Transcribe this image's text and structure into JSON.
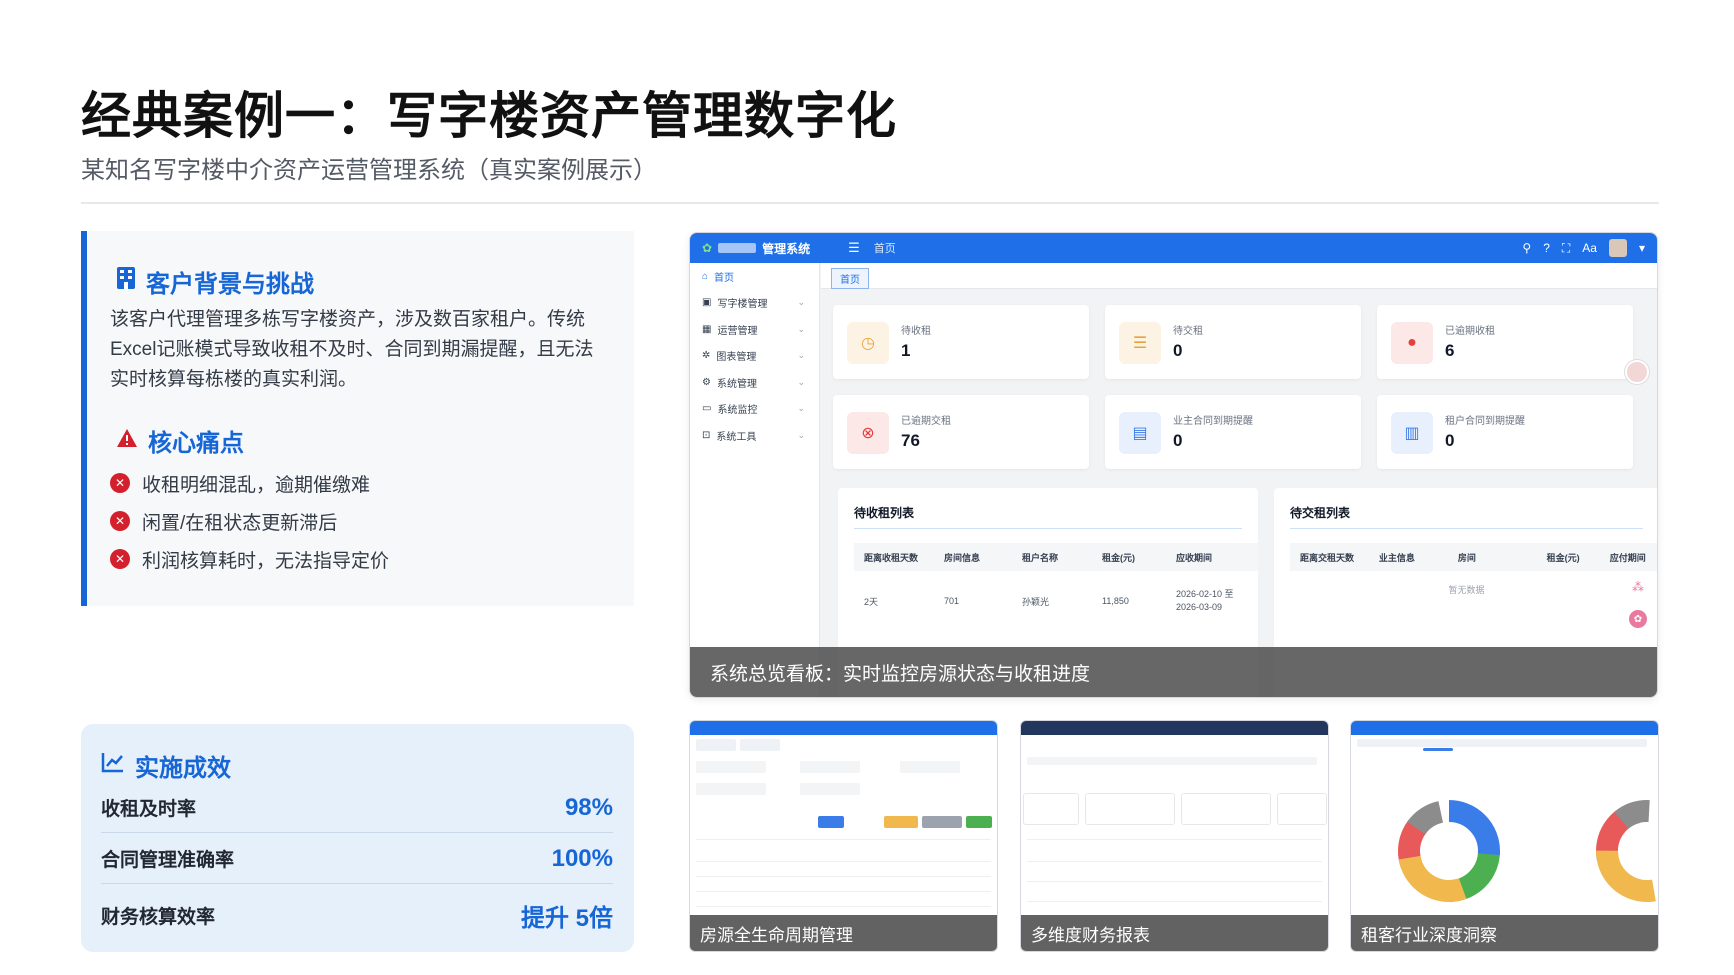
{
  "header": {
    "title": "经典案例一：写字楼资产管理数字化",
    "subtitle": "某知名写字楼中介资产运营管理系统（真实案例展示）"
  },
  "background": {
    "title": "客户背景与挑战",
    "text": "该客户代理管理多栋写字楼资产，涉及数百家租户。传统Excel记账模式导致收租不及时、合同到期漏提醒，且无法实时核算每栋楼的真实利润。",
    "pain_title": "核心痛点",
    "pain_points": [
      "收租明细混乱，逾期催缴难",
      "闲置/在租状态更新滞后",
      "利润核算耗时，无法指导定价"
    ]
  },
  "results": {
    "title": "实施成效",
    "rows": [
      {
        "label": "收租及时率",
        "value": "98%"
      },
      {
        "label": "合同管理准确率",
        "value": "100%"
      },
      {
        "label": "财务核算效率",
        "value": "提升 5倍"
      }
    ]
  },
  "screenshot": {
    "brand": "管理系统",
    "breadcrumb": "首页",
    "tab": "首页",
    "sidebar": [
      "首页",
      "写字楼管理",
      "运营管理",
      "图表管理",
      "系统管理",
      "系统监控",
      "系统工具"
    ],
    "stats": [
      {
        "label": "待收租",
        "value": "1"
      },
      {
        "label": "待交租",
        "value": "0"
      },
      {
        "label": "已逾期收租",
        "value": "6"
      },
      {
        "label": "已逾期交租",
        "value": "76"
      },
      {
        "label": "业主合同到期提醒",
        "value": "0"
      },
      {
        "label": "租户合同到期提醒",
        "value": "0"
      }
    ],
    "list1": {
      "title": "待收租列表",
      "headers": [
        "距离收租天数",
        "房间信息",
        "租户名称",
        "租金(元)",
        "应收期间"
      ],
      "row": [
        "2天",
        "701",
        "孙颖光",
        "11,850",
        "2026-02-10 至 2026-03-09"
      ]
    },
    "list2": {
      "title": "待交租列表",
      "headers": [
        "距离交租天数",
        "业主信息",
        "房间",
        "租金(元)",
        "应付期间"
      ],
      "empty": "暂无数据"
    },
    "caption": "系统总览看板：实时监控房源状态与收租进度"
  },
  "thumbs": [
    {
      "caption": "房源全生命周期管理"
    },
    {
      "caption": "多维度财务报表"
    },
    {
      "caption": "租客行业深度洞察"
    }
  ],
  "colors": {
    "accent": "#1766d6",
    "topbar": "#1e6fe8",
    "danger": "#d3202c"
  }
}
